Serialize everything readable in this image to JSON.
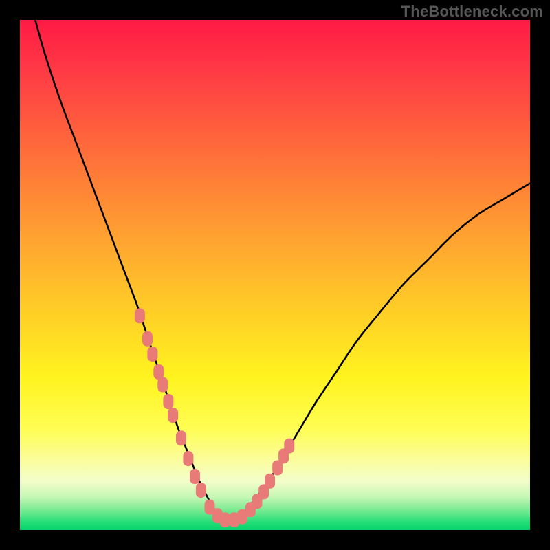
{
  "watermark": "TheBottleneck.com",
  "colors": {
    "frame": "#000000",
    "curve_stroke": "#000000",
    "marker_fill": "#e87b78",
    "gradient_stops": [
      {
        "offset": 0.0,
        "color": "#ff1a44"
      },
      {
        "offset": 0.1,
        "color": "#ff3a45"
      },
      {
        "offset": 0.25,
        "color": "#ff6a3b"
      },
      {
        "offset": 0.4,
        "color": "#ff9a32"
      },
      {
        "offset": 0.55,
        "color": "#ffc828"
      },
      {
        "offset": 0.7,
        "color": "#fff31f"
      },
      {
        "offset": 0.8,
        "color": "#fffd52"
      },
      {
        "offset": 0.865,
        "color": "#fbfd9f"
      },
      {
        "offset": 0.905,
        "color": "#f2fdca"
      },
      {
        "offset": 0.935,
        "color": "#c6f7b4"
      },
      {
        "offset": 0.96,
        "color": "#7ceb92"
      },
      {
        "offset": 0.985,
        "color": "#24dd77"
      },
      {
        "offset": 1.0,
        "color": "#03d36e"
      }
    ]
  },
  "chart_data": {
    "type": "line",
    "title": "",
    "xlabel": "",
    "ylabel": "",
    "xlim": [
      0,
      100
    ],
    "ylim": [
      0,
      100
    ],
    "grid": false,
    "series": [
      {
        "name": "bottleneck-curve",
        "x": [
          3,
          5,
          8,
          11,
          14,
          17,
          20,
          23,
          25,
          27,
          29,
          31,
          33,
          35,
          37,
          38.5,
          40,
          42,
          44,
          46,
          49,
          52,
          55,
          58,
          62,
          66,
          70,
          75,
          80,
          85,
          90,
          95,
          100
        ],
        "y": [
          100,
          93,
          84,
          76,
          68,
          60,
          52,
          44,
          38,
          32,
          26,
          20,
          15,
          10,
          6,
          3.5,
          2,
          2,
          3.5,
          6,
          10,
          15,
          20,
          25,
          31,
          37,
          42,
          48,
          53,
          58,
          62,
          65,
          68
        ]
      }
    ],
    "markers": {
      "name": "highlighted-points",
      "x": [
        23.5,
        25.0,
        26.0,
        27.2,
        28.0,
        29.1,
        30.0,
        31.6,
        33.0,
        34.3,
        35.5,
        37.2,
        38.7,
        40.2,
        42.0,
        43.6,
        45.2,
        46.5,
        47.8,
        49.0,
        50.5,
        51.7,
        52.8
      ],
      "y": [
        42.0,
        37.5,
        34.5,
        31.0,
        28.5,
        25.2,
        22.5,
        18.0,
        14.0,
        10.5,
        7.8,
        4.5,
        2.8,
        2.0,
        2.0,
        2.6,
        4.0,
        5.6,
        7.5,
        9.6,
        12.2,
        14.5,
        16.5
      ]
    }
  }
}
